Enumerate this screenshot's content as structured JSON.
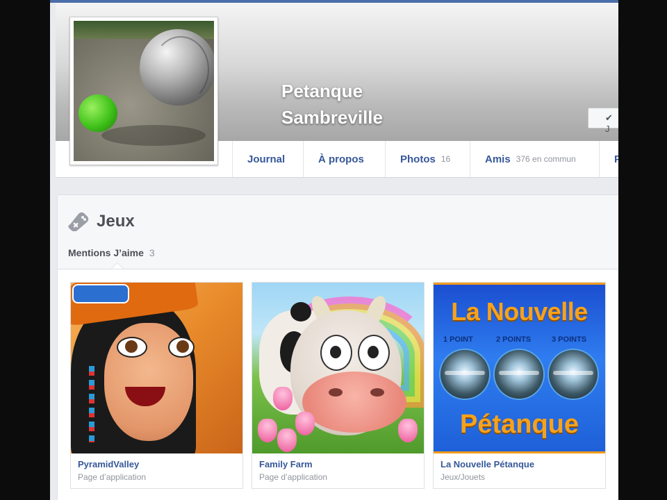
{
  "profile": {
    "name": "Petanque\nSambreville"
  },
  "cover_actions": {
    "like_label": "✔ J"
  },
  "tabs": [
    {
      "label": "Journal",
      "count": ""
    },
    {
      "label": "À propos",
      "count": ""
    },
    {
      "label": "Photos",
      "count": "16"
    },
    {
      "label": "Amis",
      "count": "376 en commun"
    },
    {
      "label": "P",
      "count": ""
    }
  ],
  "section": {
    "icon": "gamepad-icon",
    "title": "Jeux",
    "subtab_label": "Mentions J’aime",
    "subtab_count": "3"
  },
  "games": [
    {
      "title": "PyramidValley",
      "subtitle": "Page d’application"
    },
    {
      "title": "Family Farm",
      "subtitle": "Page d’application"
    },
    {
      "title": "La Nouvelle Pétanque",
      "subtitle": "Jeux/Jouets"
    }
  ],
  "game_art": {
    "lnp_title_top": "La Nouvelle",
    "lnp_title_bottom": "Pétanque",
    "lnp_points": [
      "1 POINT",
      "2 POINTS",
      "3 POINTS"
    ]
  },
  "colors": {
    "link_blue": "#365899",
    "accent_orange": "#f7a21b",
    "page_bg": "#e9ebee"
  }
}
